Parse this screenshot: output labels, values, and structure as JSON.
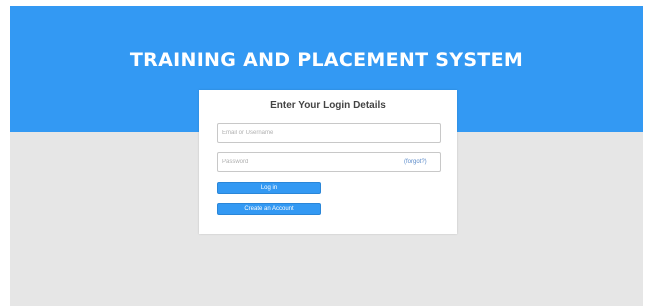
{
  "header": {
    "title": "TRAINING AND PLACEMENT SYSTEM"
  },
  "login": {
    "heading": "Enter Your Login Details",
    "email_placeholder": "Email or Username",
    "password_placeholder": "Password",
    "forgot_label": "(forgot?)",
    "login_label": "Log in",
    "create_account_label": "Create an Account"
  },
  "colors": {
    "banner": "#3399f3",
    "background": "#e6e6e6",
    "button": "#3399f3",
    "card": "#ffffff"
  }
}
